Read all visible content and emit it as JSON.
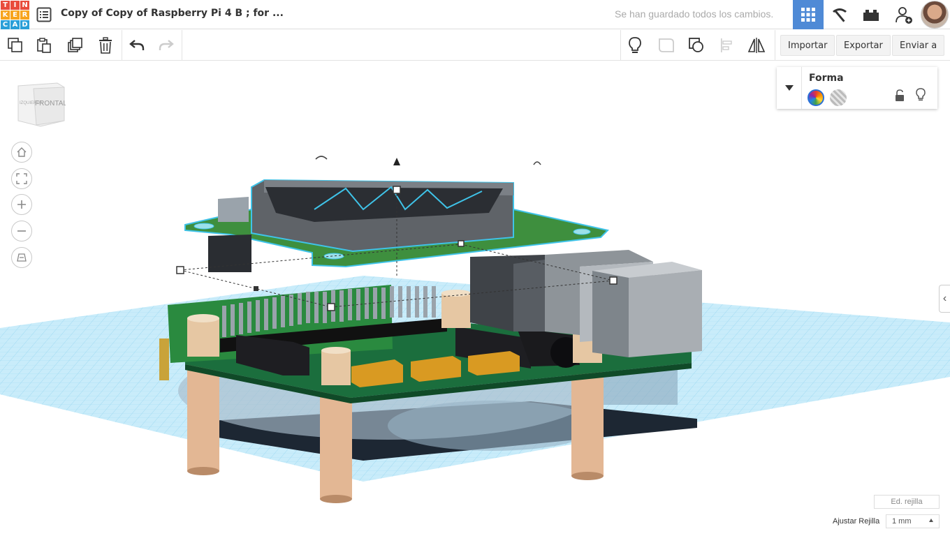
{
  "app": {
    "logo_letters": [
      "T",
      "I",
      "N",
      "K",
      "E",
      "R",
      "C",
      "A",
      "D"
    ],
    "logo_colors": [
      "#e94b3c",
      "#e94b3c",
      "#e94b3c",
      "#f7a41d",
      "#f7a41d",
      "#f7a41d",
      "#2a9fd8",
      "#2a9fd8",
      "#2a9fd8"
    ]
  },
  "header": {
    "title": "Copy of Copy of Raspberry Pi 4 B ; for ...",
    "save_status": "Se han guardado todos los cambios."
  },
  "toolbar": {
    "import_label": "Importar",
    "export_label": "Exportar",
    "send_label": "Enviar a"
  },
  "viewcube": {
    "left_face": "IZQUIERDA",
    "front_face": "FRONTAL"
  },
  "shape_panel": {
    "title": "Forma"
  },
  "grid": {
    "edit_label": "Ed. rejilla",
    "snap_label": "Ajustar Rejilla",
    "snap_value": "1 mm"
  },
  "colors": {
    "accent": "#4f8ad6",
    "grid_plane": "#bfe7f7",
    "board_green": "#1e6b3c",
    "selection_cyan": "#3fc3e8"
  }
}
